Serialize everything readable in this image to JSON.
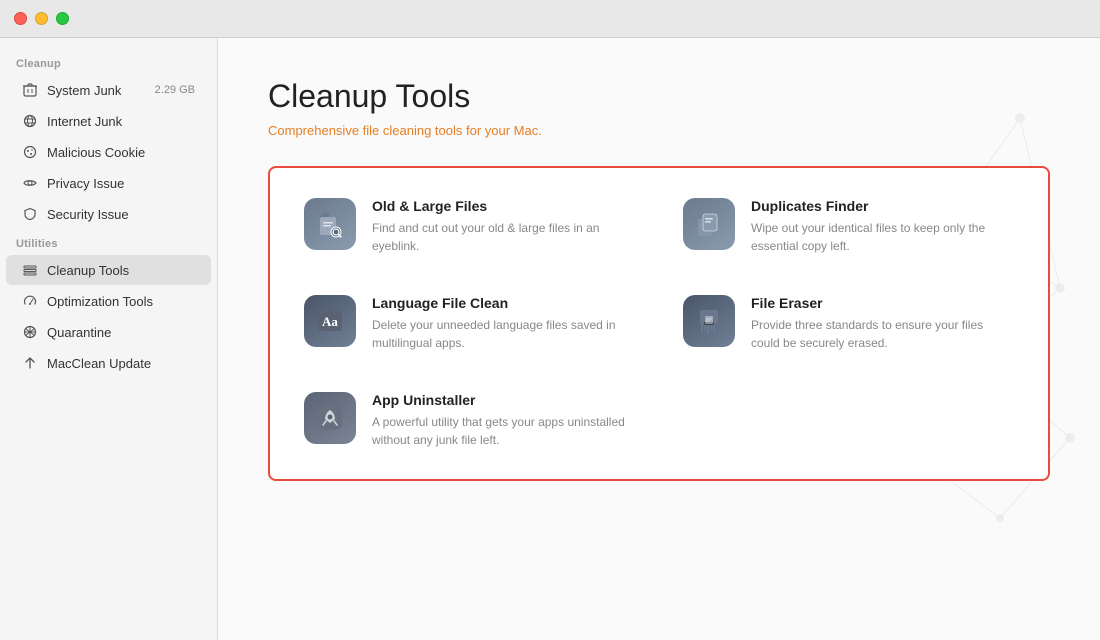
{
  "titlebar": {
    "close": "close",
    "minimize": "minimize",
    "maximize": "maximize"
  },
  "sidebar": {
    "cleanup_label": "Cleanup",
    "utilities_label": "Utilities",
    "items_cleanup": [
      {
        "id": "system-junk",
        "label": "System Junk",
        "badge": "2.29 GB",
        "icon": "trash"
      },
      {
        "id": "internet-junk",
        "label": "Internet Junk",
        "badge": "",
        "icon": "globe"
      },
      {
        "id": "malicious-cookie",
        "label": "Malicious Cookie",
        "badge": "",
        "icon": "cookie"
      },
      {
        "id": "privacy-issue",
        "label": "Privacy Issue",
        "badge": "",
        "icon": "eye"
      },
      {
        "id": "security-issue",
        "label": "Security Issue",
        "badge": "",
        "icon": "shield"
      }
    ],
    "items_utilities": [
      {
        "id": "cleanup-tools",
        "label": "Cleanup Tools",
        "badge": "",
        "icon": "tools",
        "active": true
      },
      {
        "id": "optimization-tools",
        "label": "Optimization Tools",
        "badge": "",
        "icon": "gauge"
      },
      {
        "id": "quarantine",
        "label": "Quarantine",
        "badge": "",
        "icon": "quarantine"
      },
      {
        "id": "macclean-update",
        "label": "MacClean Update",
        "badge": "",
        "icon": "arrow-up"
      }
    ]
  },
  "main": {
    "title": "Cleanup Tools",
    "subtitle": "Comprehensive file cleaning tools for your Mac.",
    "tools": [
      {
        "id": "old-large-files",
        "name": "Old & Large Files",
        "desc": "Find and cut out your old & large files in an eyeblink.",
        "icon": "📦"
      },
      {
        "id": "duplicates-finder",
        "name": "Duplicates Finder",
        "desc": "Wipe out your identical files to keep only the essential copy left.",
        "icon": "📄"
      },
      {
        "id": "language-file-clean",
        "name": "Language File Clean",
        "desc": "Delete your unneeded language files saved in multilingual apps.",
        "icon": "🔤"
      },
      {
        "id": "file-eraser",
        "name": "File Eraser",
        "desc": "Provide three standards to ensure your files could be securely erased.",
        "icon": "🗑"
      },
      {
        "id": "app-uninstaller",
        "name": "App Uninstaller",
        "desc": "A powerful utility that gets your apps uninstalled without any junk file left.",
        "icon": "🔧"
      }
    ]
  }
}
